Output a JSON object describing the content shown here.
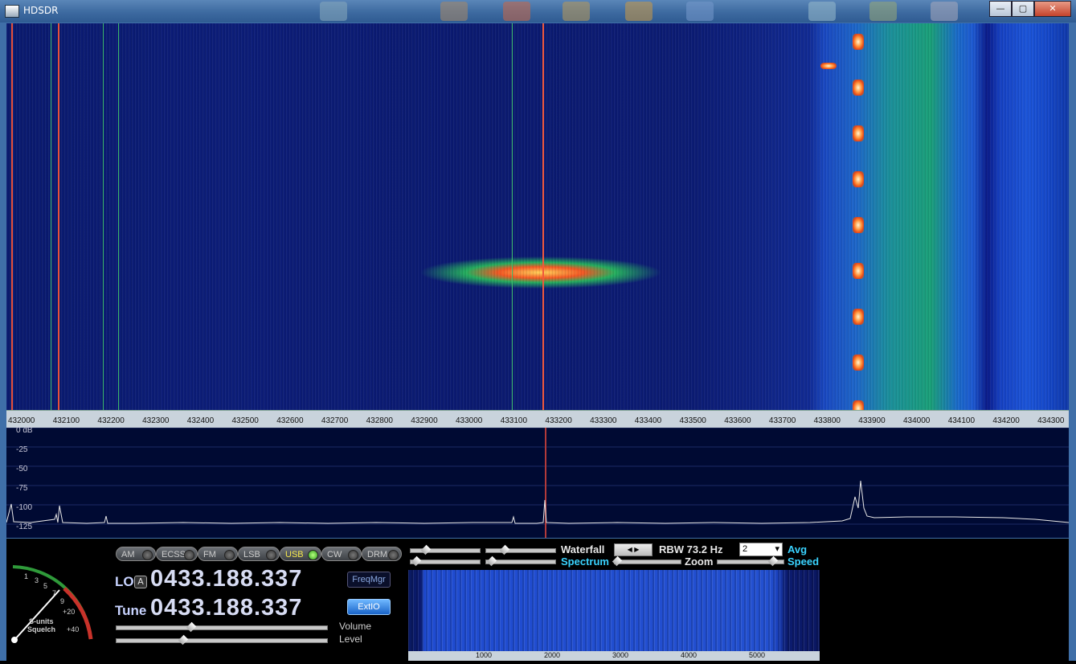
{
  "window": {
    "title": "HDSDR",
    "minimize": "—",
    "maximize": "▢",
    "close": "✕"
  },
  "waterfall": {
    "freq_ticks": [
      "432000",
      "432100",
      "432200",
      "432300",
      "432400",
      "432500",
      "432600",
      "432700",
      "432800",
      "432900",
      "433000",
      "433100",
      "433200",
      "433300",
      "433400",
      "433500",
      "433600",
      "433700",
      "433800",
      "433900",
      "434000",
      "434100",
      "434200",
      "434300"
    ]
  },
  "spectrum": {
    "db_labels": [
      "0 dB",
      "-25",
      "-50",
      "-75",
      "-100",
      "-125"
    ]
  },
  "modes": [
    {
      "label": "AM",
      "active": false
    },
    {
      "label": "ECSS",
      "active": false
    },
    {
      "label": "FM",
      "active": false
    },
    {
      "label": "LSB",
      "active": false
    },
    {
      "label": "USB",
      "active": true
    },
    {
      "label": "CW",
      "active": false
    },
    {
      "label": "DRM",
      "active": false
    }
  ],
  "tuning": {
    "lo_label": "LO",
    "lo_badge": "A",
    "lo_freq": "0433.188.337",
    "tune_label": "Tune",
    "tune_freq": "0433.188.337"
  },
  "buttons": {
    "freqmgr": "FreqMgr",
    "extio": "ExtIO"
  },
  "levels": {
    "volume_label": "Volume",
    "level_label": "Level"
  },
  "smeter": {
    "scale": [
      "1",
      "3",
      "5",
      "7",
      "9",
      "+20",
      "+40"
    ],
    "line1": "S-units",
    "line2": "Squelch"
  },
  "controls": {
    "waterfall_label": "Waterfall",
    "spectrum_label": "Spectrum",
    "rbw": "RBW 73.2 Hz",
    "zoom_label": "Zoom",
    "avg_select": "2",
    "avg_label": "Avg",
    "speed_label": "Speed"
  },
  "audio_axis": [
    "1000",
    "2000",
    "3000",
    "4000",
    "5000"
  ],
  "colors": {
    "accent_cyan": "#3ad3ff",
    "freq_digits": "#d7dcf3",
    "active_mode": "#f6e84c"
  }
}
